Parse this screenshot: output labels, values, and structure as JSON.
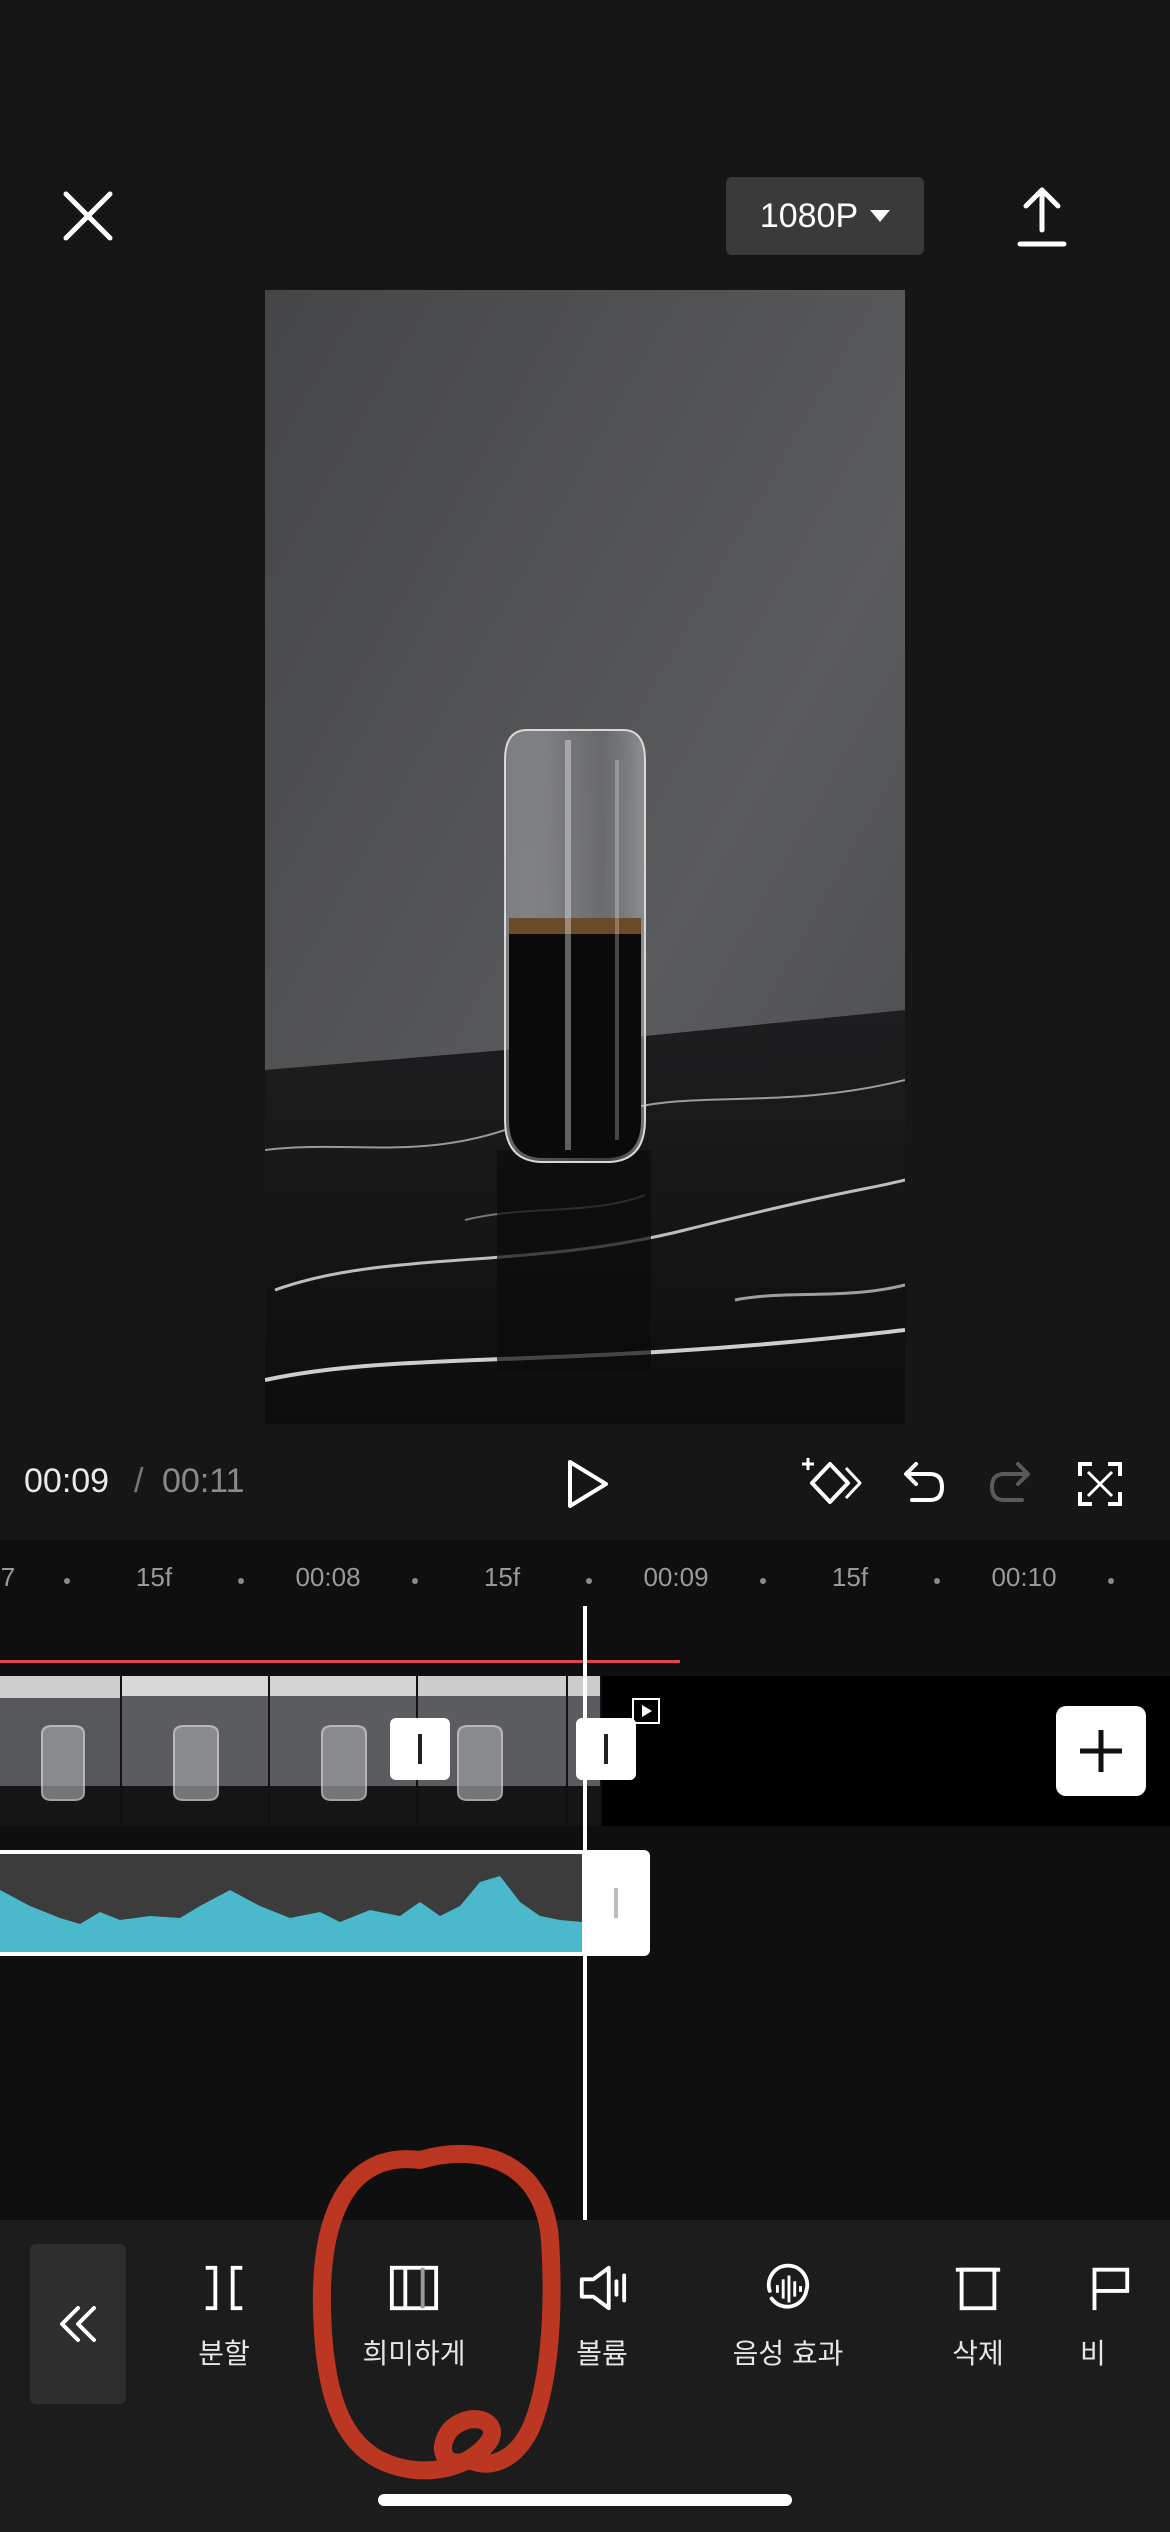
{
  "top_bar": {
    "close_icon": "close-icon",
    "resolution_label": "1080P",
    "export_icon": "upload-icon"
  },
  "playback": {
    "current_time": "00:09",
    "separator": "/",
    "total_time": "00:11",
    "icons": [
      "play-icon",
      "keyframe-icon",
      "undo-icon",
      "redo-icon",
      "fullscreen-icon"
    ]
  },
  "timeline": {
    "ruler": [
      {
        "label": "7"
      },
      {
        "label": "15f"
      },
      {
        "label": "00:08"
      },
      {
        "label": "15f"
      },
      {
        "label": "00:09"
      },
      {
        "label": "15f"
      },
      {
        "label": "00:10"
      }
    ],
    "accent_color": "#e0444f",
    "audio_color": "#4ab9cb"
  },
  "toolbar": {
    "back_icon": "double-chevron-left-icon",
    "tools": [
      {
        "label": "분할",
        "icon": "split-icon"
      },
      {
        "label": "희미하게",
        "icon": "fade-icon"
      },
      {
        "label": "볼륨",
        "icon": "volume-icon"
      },
      {
        "label": "음성 효과",
        "icon": "voice-effect-icon"
      },
      {
        "label": "삭제",
        "icon": "delete-icon"
      },
      {
        "label": "비",
        "icon": "more-icon"
      }
    ]
  }
}
